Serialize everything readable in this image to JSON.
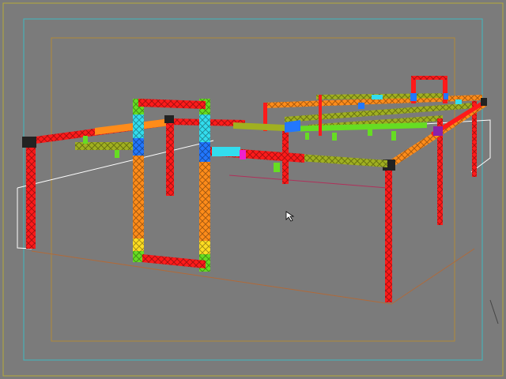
{
  "viewport": {
    "background": "#7b7b7b",
    "safe_frame_outer_color": "#b5a93a",
    "safe_frame_title_color": "#3fb8c0",
    "safe_frame_action_color": "#b08a3a",
    "ground_plane_color": "#ffffff",
    "ground_floor_color": "#b06a3a",
    "cursor_icon": "cursor-arrow-icon"
  },
  "materials": {
    "red": "#ff1a1a",
    "orange": "#ff8c1a",
    "olive": "#a0b020",
    "green": "#66dd22",
    "cyan": "#33ddee",
    "blue": "#2277ff",
    "magenta": "#ee22cc",
    "dark": "#222222"
  }
}
